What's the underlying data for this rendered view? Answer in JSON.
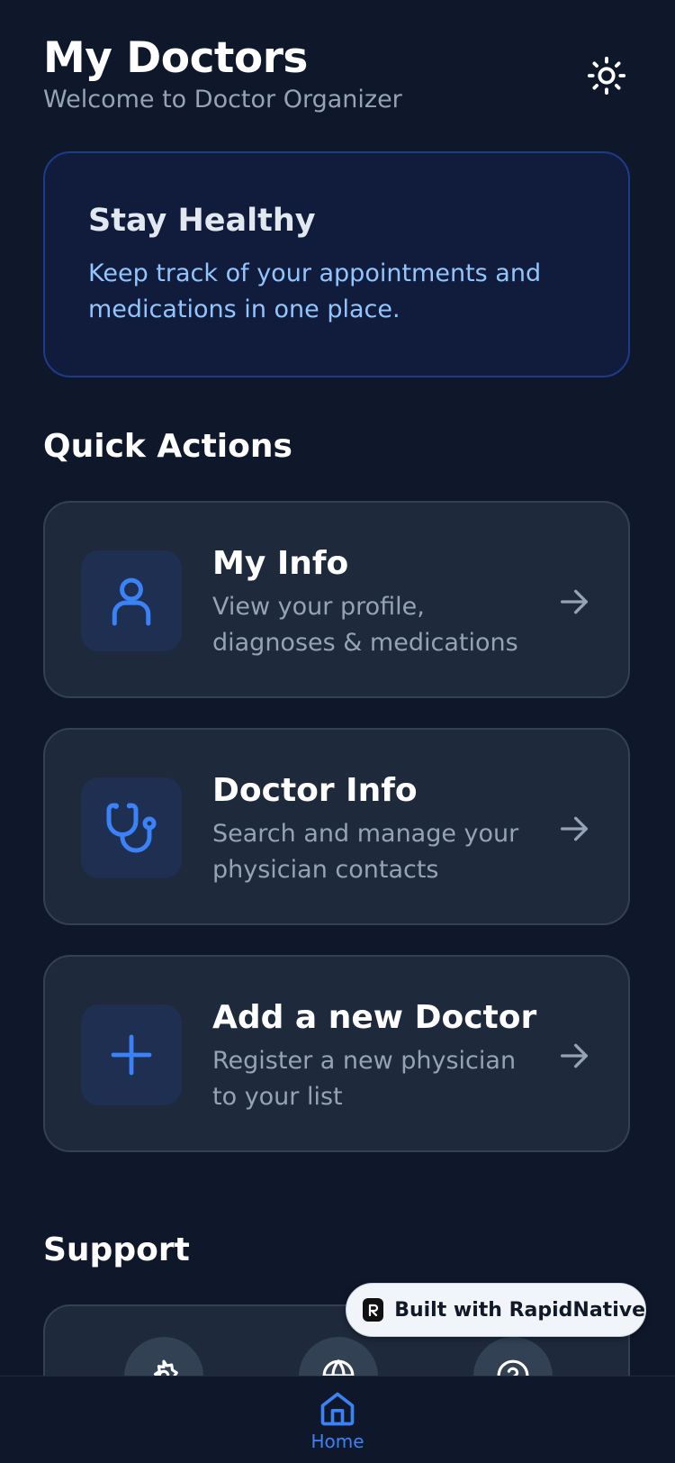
{
  "header": {
    "title": "My Doctors",
    "subtitle": "Welcome to Doctor Organizer",
    "theme_icon": "sun-icon"
  },
  "banner": {
    "title": "Stay Healthy",
    "text": "Keep track of your appointments and medications in one place."
  },
  "quick_actions": {
    "title": "Quick Actions",
    "items": [
      {
        "icon": "user-icon",
        "title": "My Info",
        "description": "View your profile, diagnoses & medications"
      },
      {
        "icon": "stethoscope-icon",
        "title": "Doctor Info",
        "description": "Search and manage your physician contacts"
      },
      {
        "icon": "plus-icon",
        "title": "Add a new Doctor",
        "description": "Register a new physician to your list"
      }
    ]
  },
  "support": {
    "title": "Support",
    "items": [
      {
        "icon": "settings-icon"
      },
      {
        "icon": "globe-icon"
      },
      {
        "icon": "help-icon"
      }
    ]
  },
  "badge": {
    "label": "Built with RapidNative"
  },
  "tabbar": {
    "items": [
      {
        "icon": "home-icon",
        "label": "Home",
        "active": true
      }
    ]
  },
  "colors": {
    "background": "#0f172a",
    "card": "#1e293b",
    "accent": "#3b82f6",
    "banner_text": "#93c5fd",
    "muted_text": "#94a3b8"
  }
}
